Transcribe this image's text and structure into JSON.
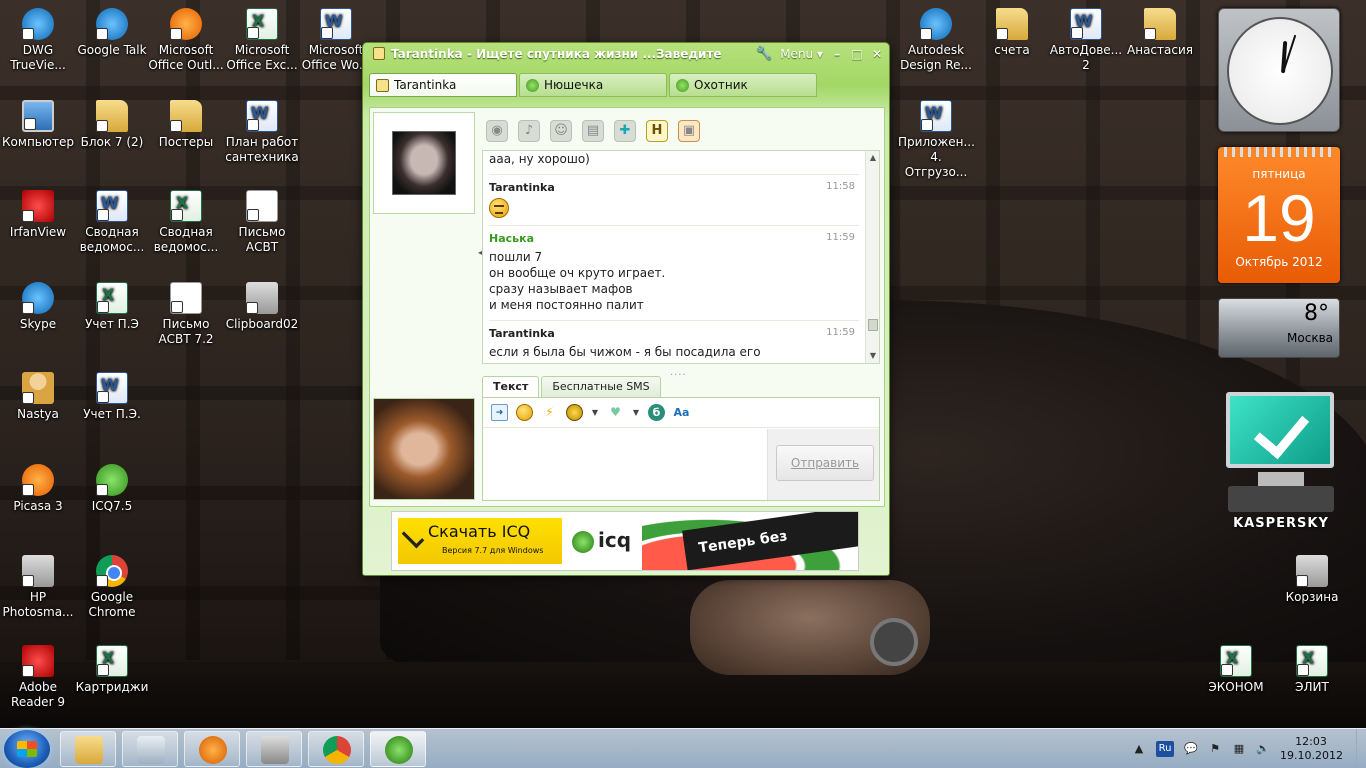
{
  "desktop": {
    "icons": [
      {
        "label": "DWG TrueVie...",
        "type": "blue"
      },
      {
        "label": "Google Talk",
        "type": "blue"
      },
      {
        "label": "Microsoft Office Outl...",
        "type": "orange"
      },
      {
        "label": "Microsoft Office Exc...",
        "type": "excel"
      },
      {
        "label": "Microsoft Office Wo...",
        "type": "word"
      },
      {
        "label": "Компьютер",
        "type": "monitor"
      },
      {
        "label": "Блок 7 (2)",
        "type": "folder"
      },
      {
        "label": "Постеры",
        "type": "folder"
      },
      {
        "label": "План работ сантехника",
        "type": "word"
      },
      {
        "label": "IrfanView",
        "type": "red"
      },
      {
        "label": "Сводная ведомос...",
        "type": "word"
      },
      {
        "label": "Сводная ведомос...",
        "type": "excel"
      },
      {
        "label": "Письмо АСВТ",
        "type": "doc"
      },
      {
        "label": "Skype",
        "type": "blue"
      },
      {
        "label": "Учет П.Э",
        "type": "excel"
      },
      {
        "label": "Письмо АСВТ 7.2",
        "type": "doc"
      },
      {
        "label": "Clipboard02",
        "type": "gray"
      },
      {
        "label": "Nastya",
        "type": "person"
      },
      {
        "label": "Учет П.Э.",
        "type": "word"
      },
      {
        "label": "Picasa 3",
        "type": "orange"
      },
      {
        "label": "ICQ7.5",
        "type": "green"
      },
      {
        "label": "HP Photosma...",
        "type": "gray"
      },
      {
        "label": "Google Chrome",
        "type": "chrome"
      },
      {
        "label": "Adobe Reader 9",
        "type": "red"
      },
      {
        "label": "Картриджи",
        "type": "excel"
      },
      {
        "label": "Autodesk Design Re...",
        "type": "blue"
      },
      {
        "label": "счета",
        "type": "folder"
      },
      {
        "label": "АвтоДове... 2",
        "type": "word"
      },
      {
        "label": "Анастасия",
        "type": "folder"
      },
      {
        "label": "Приложен... 4. Отгрузо...",
        "type": "word"
      },
      {
        "label": "Корзина",
        "type": "gray"
      },
      {
        "label": "ЭКОНОМ",
        "type": "excel"
      },
      {
        "label": "ЭЛИТ",
        "type": "excel"
      }
    ]
  },
  "gadgets": {
    "calendar": {
      "weekday": "пятница",
      "day": "19",
      "month": "Октябрь 2012"
    },
    "weather": {
      "temp": "8°",
      "city": "Москва"
    },
    "antivirus": {
      "brand": "KASPERSKY"
    }
  },
  "icq": {
    "title": "Tarantinka - Ищете спутника жизни ...Заведите",
    "menu_label": "Menu",
    "tabs": [
      {
        "label": "Tarantinka",
        "active": true
      },
      {
        "label": "Нюшечка",
        "active": false
      },
      {
        "label": "Охотник",
        "active": false
      }
    ],
    "messages": [
      {
        "nick": "",
        "time": "",
        "lines": [
          "ааа, ну хорошо)"
        ]
      },
      {
        "nick": "Tarantinka",
        "time": "11:58",
        "smiley": true,
        "lines": []
      },
      {
        "nick": "Наська",
        "time": "11:59",
        "green": true,
        "lines": [
          "пошли 7",
          "он вообще оч круто играет.",
          "сразу называет мафов",
          "и меня постоянно палит"
        ]
      },
      {
        "nick": "Tarantinka",
        "time": "11:59",
        "lines": [
          "если я была бы чижом - я бы посадила его"
        ]
      }
    ],
    "input_tabs": [
      {
        "label": "Текст",
        "active": true
      },
      {
        "label": "Бесплатные SMS",
        "active": false
      }
    ],
    "send_label": "Отправить",
    "ad": {
      "download": "Скачать ICQ",
      "version": "Версия 7.7 для Windows",
      "logo": "icq",
      "slogan": "Теперь без рекламы"
    }
  },
  "taskbar": {
    "lang": "Ru",
    "time": "12:03",
    "date": "19.10.2012"
  }
}
